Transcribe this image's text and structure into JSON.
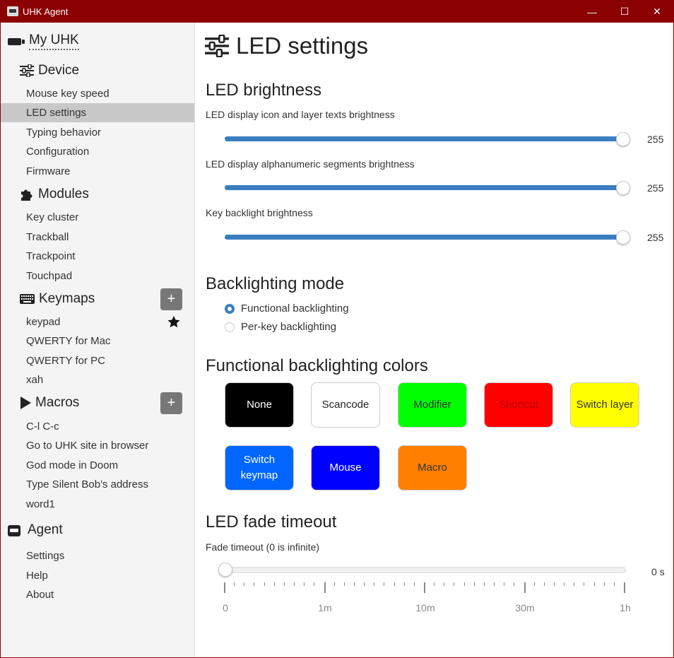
{
  "titlebar": {
    "title": "UHK Agent",
    "minimize_icon": "—",
    "maximize_icon": "☐",
    "close_icon": "✕"
  },
  "sidebar": {
    "my_uhk": "My UHK",
    "device": {
      "label": "Device",
      "items": [
        "Mouse key speed",
        "LED settings",
        "Typing behavior",
        "Configuration",
        "Firmware"
      ]
    },
    "modules": {
      "label": "Modules",
      "items": [
        "Key cluster",
        "Trackball",
        "Trackpoint",
        "Touchpad"
      ]
    },
    "keymaps": {
      "label": "Keymaps",
      "add": "+",
      "items": [
        "keypad",
        "QWERTY for Mac",
        "QWERTY for PC",
        "xah"
      ]
    },
    "macros": {
      "label": "Macros",
      "add": "+",
      "items": [
        "C-l C-c",
        "Go to UHK site in browser",
        "God mode in Doom",
        "Type Silent Bob's address",
        "word1"
      ]
    },
    "agent": {
      "label": "Agent",
      "items": [
        "Settings",
        "Help",
        "About"
      ]
    }
  },
  "main": {
    "title": "LED settings",
    "brightness": {
      "heading": "LED brightness",
      "sliders": [
        {
          "label": "LED display icon and layer texts brightness",
          "value": "255"
        },
        {
          "label": "LED display alphanumeric segments brightness",
          "value": "255"
        },
        {
          "label": "Key backlight brightness",
          "value": "255"
        }
      ]
    },
    "backlighting_mode": {
      "heading": "Backlighting mode",
      "options": [
        "Functional backlighting",
        "Per-key backlighting"
      ],
      "selected": "Functional backlighting"
    },
    "colors": {
      "heading": "Functional backlighting colors",
      "swatches": [
        {
          "label": "None",
          "color": "#000000",
          "text": "#ffffff"
        },
        {
          "label": "Scancode",
          "color": "#ffffff",
          "text": "#222222"
        },
        {
          "label": "Modifier",
          "color": "#00ff00",
          "text": "#333333"
        },
        {
          "label": "Shortcut",
          "color": "#ff0000",
          "text": "#b30000"
        },
        {
          "label": "Switch layer",
          "color": "#ffff00",
          "text": "#333333"
        },
        {
          "label": "Switch keymap",
          "color": "#0066ff",
          "text": "#ffffff"
        },
        {
          "label": "Mouse",
          "color": "#0000ff",
          "text": "#ffffff"
        },
        {
          "label": "Macro",
          "color": "#ff7f00",
          "text": "#333333"
        }
      ]
    },
    "fade": {
      "heading": "LED fade timeout",
      "label": "Fade timeout (0 is infinite)",
      "value": "0 s",
      "ticks": [
        "0",
        "1m",
        "10m",
        "30m",
        "1h"
      ]
    }
  }
}
